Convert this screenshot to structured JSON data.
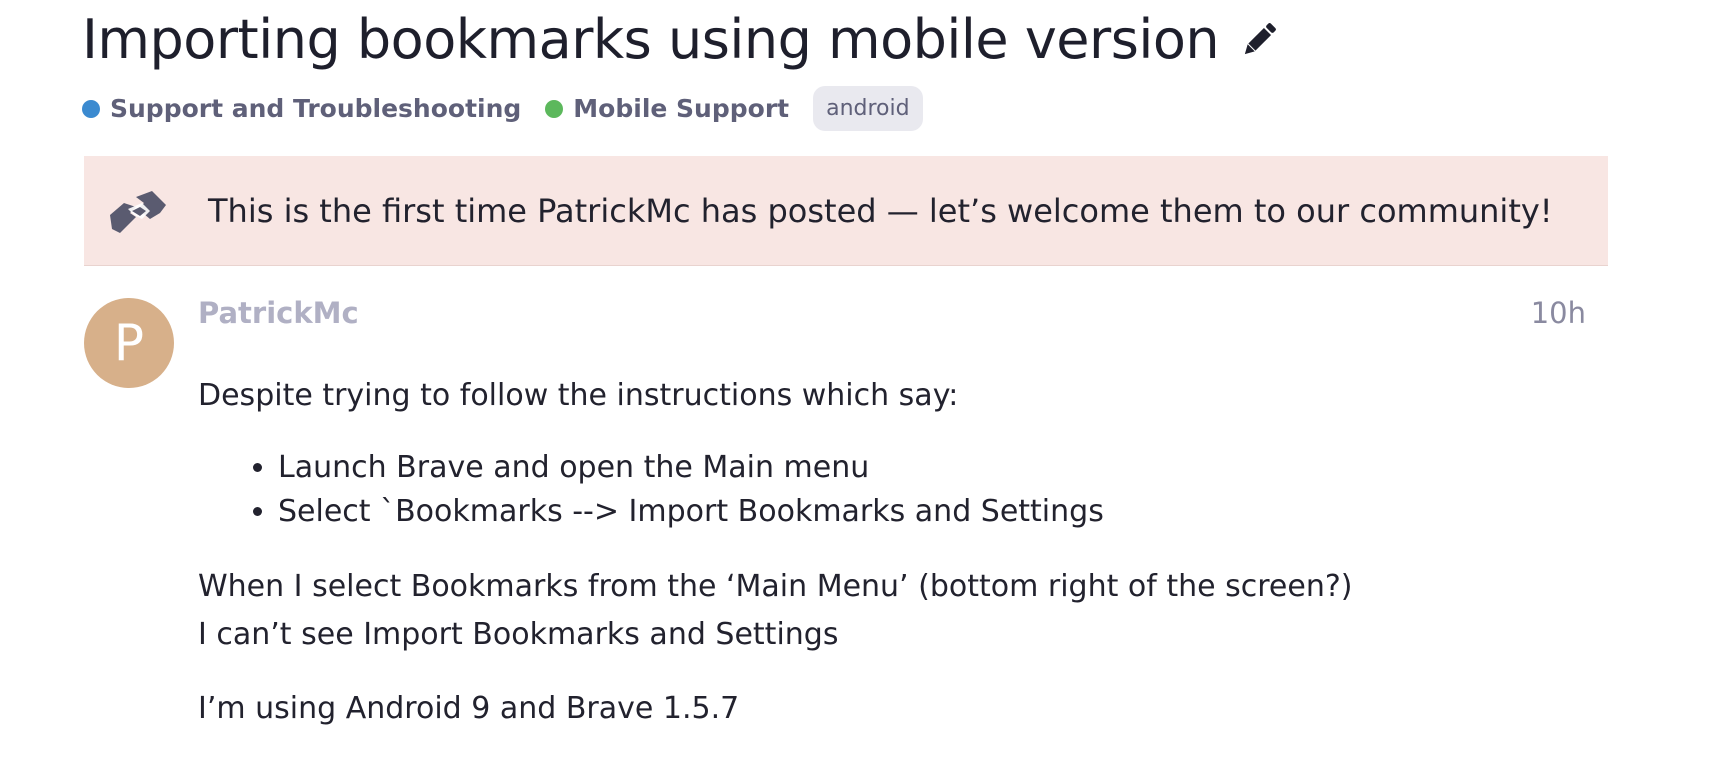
{
  "topic": {
    "title": "Importing bookmarks using mobile version",
    "edit_icon": "pencil-icon"
  },
  "categories": [
    {
      "label": "Support and Troubleshooting",
      "color": "#3b8ad0"
    },
    {
      "label": "Mobile Support",
      "color": "#5cb85c"
    }
  ],
  "tags": [
    "android"
  ],
  "welcome_notice": {
    "icon": "handshake-icon",
    "text": "This is the first time PatrickMc has posted — let’s welcome them to our community!"
  },
  "post": {
    "avatar_letter": "P",
    "avatar_color": "#d7b08a",
    "username": "PatrickMc",
    "time": "10h",
    "intro": "Despite trying to follow the instructions which say:",
    "steps": [
      "Launch Brave and open the Main menu",
      "Select `Bookmarks --> Import Bookmarks and Settings"
    ],
    "line1": "When I select Bookmarks from the ‘Main Menu’ (bottom right of the screen?)",
    "line2": "I can’t see Import Bookmarks and Settings",
    "line3": "I’m using Android 9 and Brave 1.5.7"
  }
}
